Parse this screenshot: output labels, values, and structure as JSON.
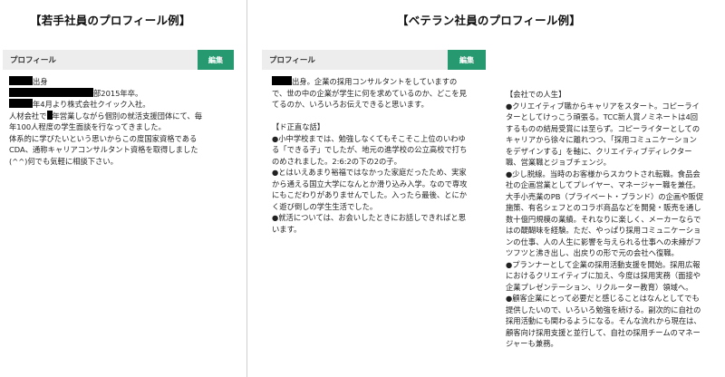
{
  "left": {
    "heading": "【若手社員のプロフィール例】",
    "bar_title": "プロフィール",
    "edit_label": "編集",
    "lines": {
      "l1": "出身",
      "l2": "部2015年卒。",
      "l3": "年4月より株式会社クイック入社。",
      "l4a": "人材会社で",
      "l4b": "年営業しながら個別の就活支援団体にて、毎",
      "l5": "年100人程度の学生面談を行なってきました。",
      "l6": "体系的に学びたいという思いからこの度国家資格である",
      "l7": "CDA、通称キャリアコンサルタント資格を取得しました",
      "l8": "(^^)何でも気軽に相談下さい。"
    }
  },
  "right": {
    "heading": "【ベテラン社員のプロフィール例】",
    "bar_title": "プロフィール",
    "edit_label": "編集",
    "mid": {
      "intro_a": "出身。企業の採用コンサルタントをしていますの",
      "intro_b": "で、世の中の企業が学生に何を求めているのか、どこを見",
      "intro_c": "てるのか、いろいろお伝えできると思います。",
      "sec_title": "【ド正直な話】",
      "p1_a": "●小中学校までは、勉強しなくてもそこそこ上位のいわゆ",
      "p1_b": "る「できる子」でしたが、地元の進学校の公立高校で打ち",
      "p1_c": "のめされました。2:6:2の下の2の子。",
      "p2_a": "●とはいえあまり裕福ではなかった家庭だったため、実家",
      "p2_b": "から通える国立大学になんとか滑り込み入学。なので専攻",
      "p2_c": "にもこだわりがありませんでした。入ったら最後、とにか",
      "p2_d": "く遊び倒しの学生生活でした。",
      "p3_a": "●就活については、お会いしたときにお話しできればと思",
      "p3_b": "います。"
    },
    "career": {
      "title": "【会社での人生】",
      "lines": [
        "●クリエイティブ職からキャリアをスタート。コピーライ",
        "ターとしてけっこう頑張る。TCC新人賞ノミネートは4回",
        "するものの結局受賞には至らず。コピーライターとしての",
        "キャリアから徐々に離れつつ、「採用コミュニケーション",
        "をデザインする」を軸に、クリエイティブディレクター",
        "職、営業職とジョブチェンジ。",
        "●少し脱線。当時のお客様からスカウトされ転職。食品会",
        "社の企画営業としてプレイヤー、マネージャー職を兼任。",
        "大手小売業のPB（プライベート・ブランド）の企画や販促",
        "施策、有名シェフとのコラボ商品などを開発・販売を通し",
        "数十億円規模の業績。それなりに楽しく、メーカーならで",
        "はの醍醐味を経験。ただ、やっぱり採用コミュニケーショ",
        "ンの仕事、人の人生に影響を与えられる仕事への未練がフ",
        "ツフツと沸き出し、出戻りの形で元の会社へ復職。",
        "●プランナーとして企業の採用活動支援を開始。採用広報",
        "におけるクリエイティブに加え、今度は採用実務（面接や",
        "企業プレゼンテーション、リクルーター教育）領域へ。",
        "●顧客企業にとって必要だと感じることはなんとしてでも",
        "提供したいので、いろいろ勉強を続ける。副次的に自社の",
        "採用活動にも関わるようになる。そんな流れから現在は、",
        "顧客向け採用支援と並行して、自社の採用チームのマネー",
        "ジャーも兼務。"
      ]
    }
  }
}
